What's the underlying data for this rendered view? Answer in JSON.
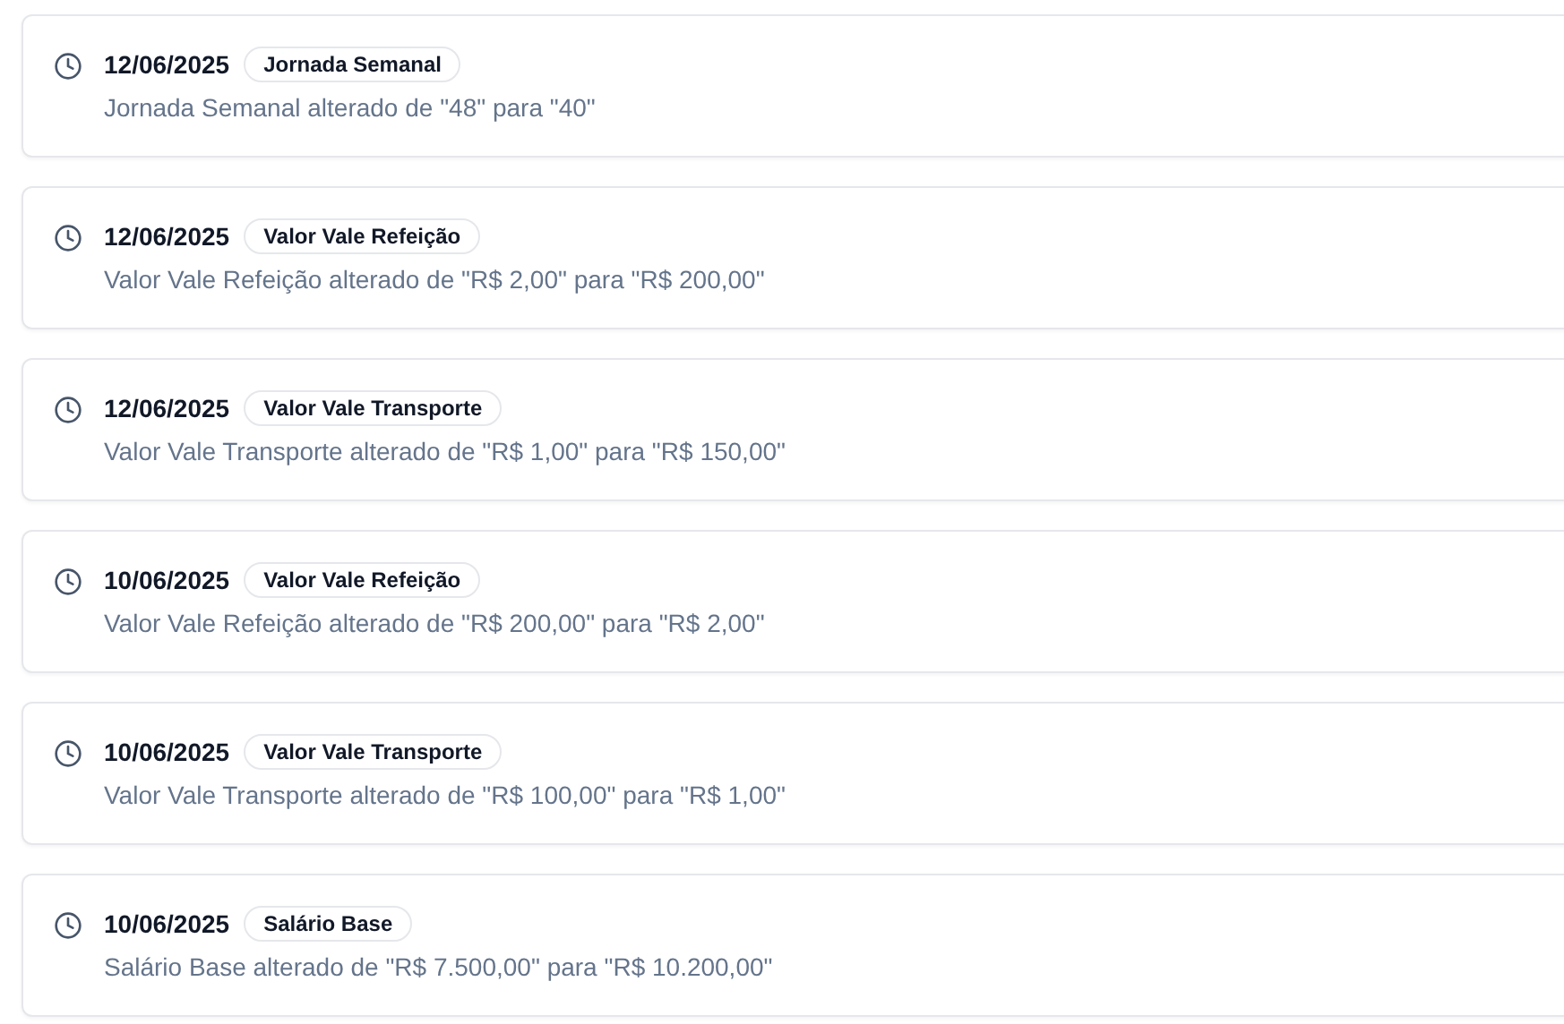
{
  "entries": [
    {
      "date": "12/06/2025",
      "tag": "Jornada Semanal",
      "description": "Jornada Semanal alterado de \"48\" para \"40\""
    },
    {
      "date": "12/06/2025",
      "tag": "Valor Vale Refeição",
      "description": "Valor Vale Refeição alterado de \"R$ 2,00\" para \"R$ 200,00\""
    },
    {
      "date": "12/06/2025",
      "tag": "Valor Vale Transporte",
      "description": "Valor Vale Transporte alterado de \"R$ 1,00\" para \"R$ 150,00\""
    },
    {
      "date": "10/06/2025",
      "tag": "Valor Vale Refeição",
      "description": "Valor Vale Refeição alterado de \"R$ 200,00\" para \"R$ 2,00\""
    },
    {
      "date": "10/06/2025",
      "tag": "Valor Vale Transporte",
      "description": "Valor Vale Transporte alterado de \"R$ 100,00\" para \"R$ 1,00\""
    },
    {
      "date": "10/06/2025",
      "tag": "Salário Base",
      "description": "Salário Base alterado de \"R$ 7.500,00\" para \"R$ 10.200,00\""
    }
  ]
}
